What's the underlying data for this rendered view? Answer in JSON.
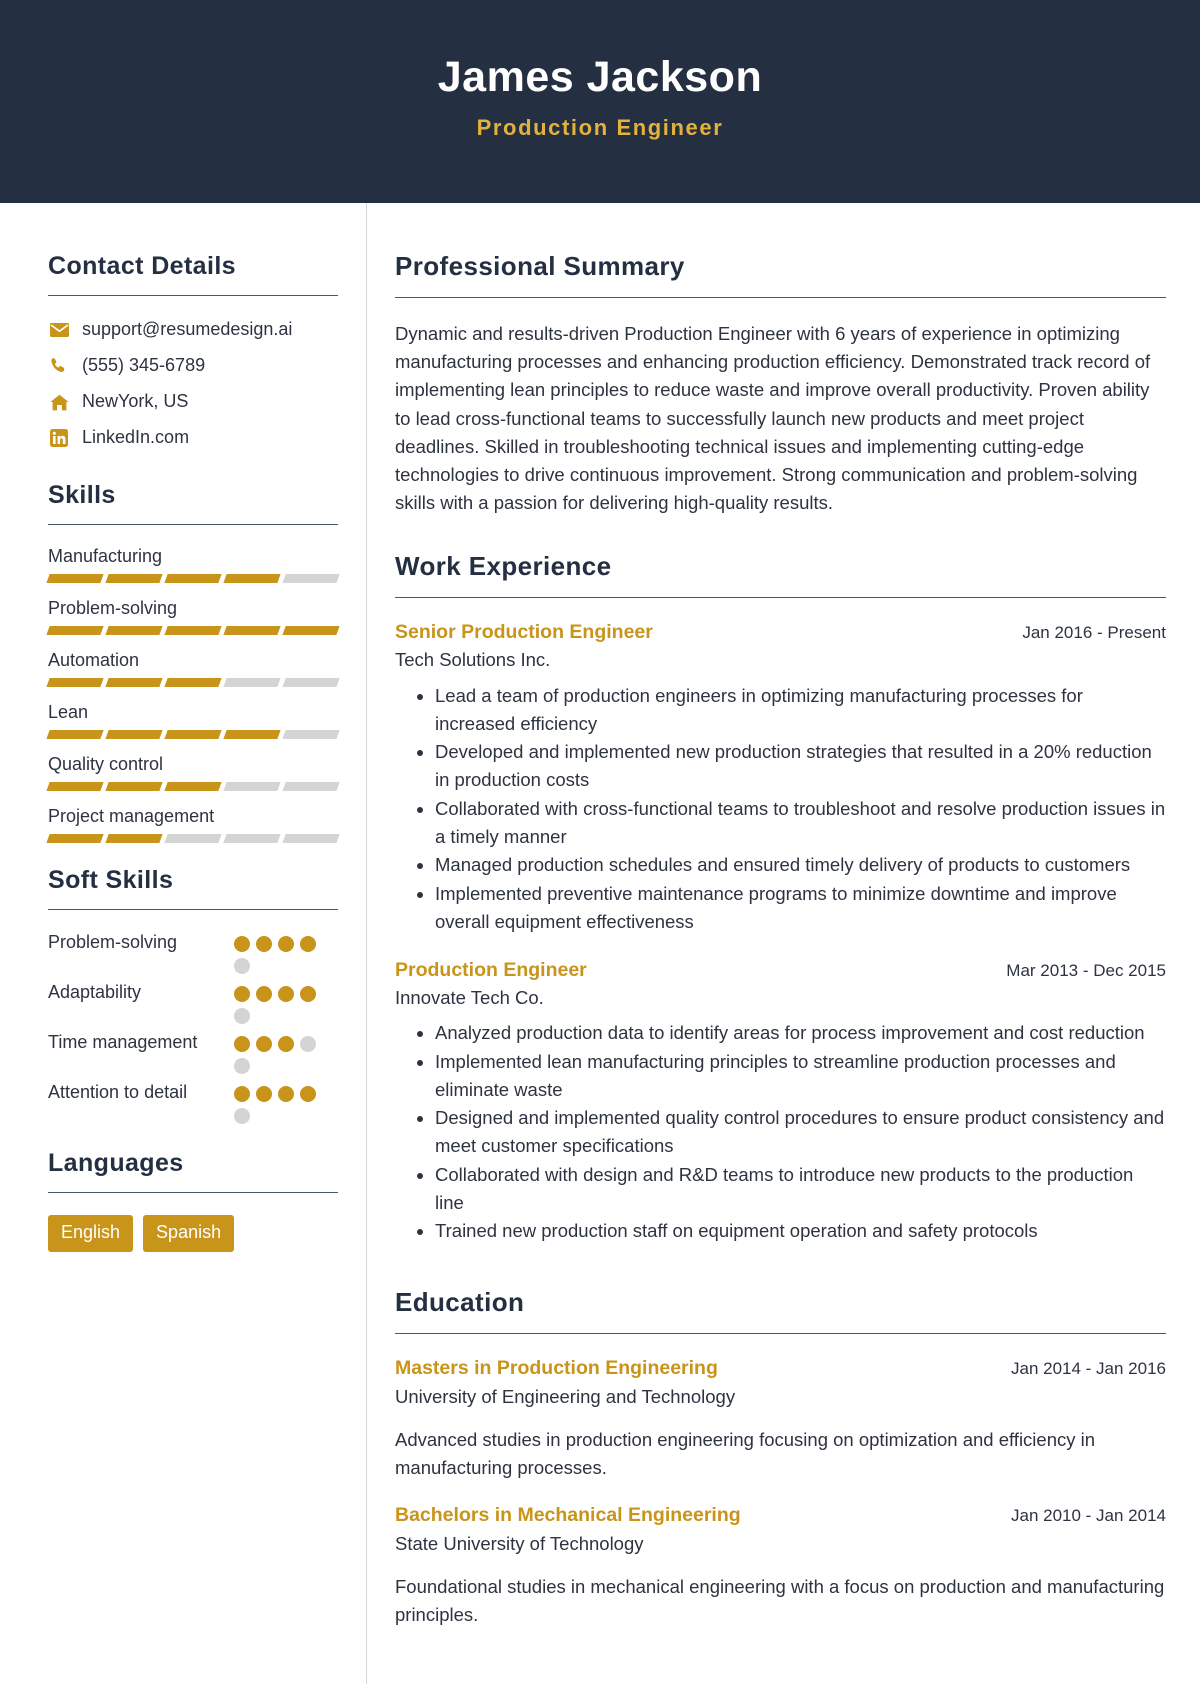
{
  "header": {
    "name": "James Jackson",
    "role": "Production Engineer",
    "bg_color": "#242f42",
    "accent_color": "#e3b23c"
  },
  "theme": {
    "gold": "#c8941a",
    "navy": "#242f42",
    "text": "#2d3340",
    "muted_bar": "#d4d4d4"
  },
  "sidebar": {
    "contact": {
      "title": "Contact Details",
      "items": [
        {
          "icon": "email-icon",
          "value": "support@resumedesign.ai"
        },
        {
          "icon": "phone-icon",
          "value": "(555) 345-6789"
        },
        {
          "icon": "home-icon",
          "value": "NewYork, US"
        },
        {
          "icon": "linkedin-icon",
          "value": "LinkedIn.com"
        }
      ]
    },
    "skills": {
      "title": "Skills",
      "max": 5,
      "items": [
        {
          "label": "Manufacturing",
          "level": 4
        },
        {
          "label": "Problem-solving",
          "level": 5
        },
        {
          "label": "Automation",
          "level": 3
        },
        {
          "label": "Lean",
          "level": 4
        },
        {
          "label": "Quality control",
          "level": 3
        },
        {
          "label": "Project management",
          "level": 2
        }
      ]
    },
    "soft_skills": {
      "title": "Soft Skills",
      "max": 5,
      "items": [
        {
          "label": "Problem-solving",
          "level": 4
        },
        {
          "label": "Adaptability",
          "level": 4
        },
        {
          "label": "Time management",
          "level": 3
        },
        {
          "label": "Attention to detail",
          "level": 4
        }
      ]
    },
    "languages": {
      "title": "Languages",
      "items": [
        "English",
        "Spanish"
      ]
    }
  },
  "main": {
    "summary": {
      "title": "Professional Summary",
      "text": "Dynamic and results-driven Production Engineer with 6 years of experience in optimizing manufacturing processes and enhancing production efficiency. Demonstrated track record of implementing lean principles to reduce waste and improve overall productivity. Proven ability to lead cross-functional teams to successfully launch new products and meet project deadlines. Skilled in troubleshooting technical issues and implementing cutting-edge technologies to drive continuous improvement. Strong communication and problem-solving skills with a passion for delivering high-quality results."
    },
    "work": {
      "title": "Work Experience",
      "entries": [
        {
          "title": "Senior Production Engineer",
          "date": "Jan 2016 - Present",
          "org": "Tech Solutions Inc.",
          "bullets": [
            "Lead a team of production engineers in optimizing manufacturing processes for increased efficiency",
            "Developed and implemented new production strategies that resulted in a 20% reduction in production costs",
            "Collaborated with cross-functional teams to troubleshoot and resolve production issues in a timely manner",
            "Managed production schedules and ensured timely delivery of products to customers",
            "Implemented preventive maintenance programs to minimize downtime and improve overall equipment effectiveness"
          ]
        },
        {
          "title": "Production Engineer",
          "date": "Mar 2013 - Dec 2015",
          "org": "Innovate Tech Co.",
          "bullets": [
            "Analyzed production data to identify areas for process improvement and cost reduction",
            "Implemented lean manufacturing principles to streamline production processes and eliminate waste",
            "Designed and implemented quality control procedures to ensure product consistency and meet customer specifications",
            "Collaborated with design and R&D teams to introduce new products to the production line",
            "Trained new production staff on equipment operation and safety protocols"
          ]
        }
      ]
    },
    "education": {
      "title": "Education",
      "entries": [
        {
          "title": "Masters in Production Engineering",
          "date": "Jan 2014 - Jan 2016",
          "org": "University of Engineering and Technology",
          "desc": "Advanced studies in production engineering focusing on optimization and efficiency in manufacturing processes."
        },
        {
          "title": "Bachelors in Mechanical Engineering",
          "date": "Jan 2010 - Jan 2014",
          "org": "State University of Technology",
          "desc": "Foundational studies in mechanical engineering with a focus on production and manufacturing principles."
        }
      ]
    }
  }
}
